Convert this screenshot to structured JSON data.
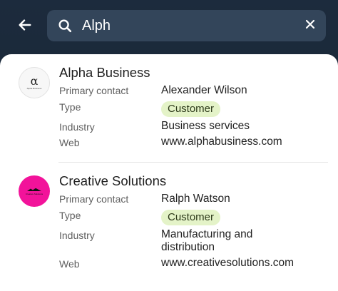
{
  "search": {
    "value": "Alph",
    "placeholder": ""
  },
  "icons": {
    "back": "arrow-left-icon",
    "search": "search-icon",
    "clear": "close-icon"
  },
  "colors": {
    "header_bg": "#1c2b3d",
    "search_bg": "#33455a",
    "badge_bg": "#e4f3c8",
    "creative_logo": "#f2139a"
  },
  "results": [
    {
      "name": "Alpha Business",
      "logo_glyph": "α",
      "logo_text": "Alpha Business",
      "fields": {
        "primary_contact_label": "Primary contact",
        "primary_contact": "Alexander Wilson",
        "type_label": "Type",
        "type": "Customer",
        "industry_label": "Industry",
        "industry": "Business services",
        "web_label": "Web",
        "web": "www.alphabusiness.com"
      }
    },
    {
      "name": "Creative Solutions",
      "logo_text": "Creative Solutions",
      "fields": {
        "primary_contact_label": "Primary contact",
        "primary_contact": "Ralph Watson",
        "type_label": "Type",
        "type": "Customer",
        "industry_label": "Industry",
        "industry_line1": "Manufacturing and",
        "industry_line2": "distribution",
        "web_label": "Web",
        "web": "www.creativesolutions.com"
      }
    }
  ]
}
